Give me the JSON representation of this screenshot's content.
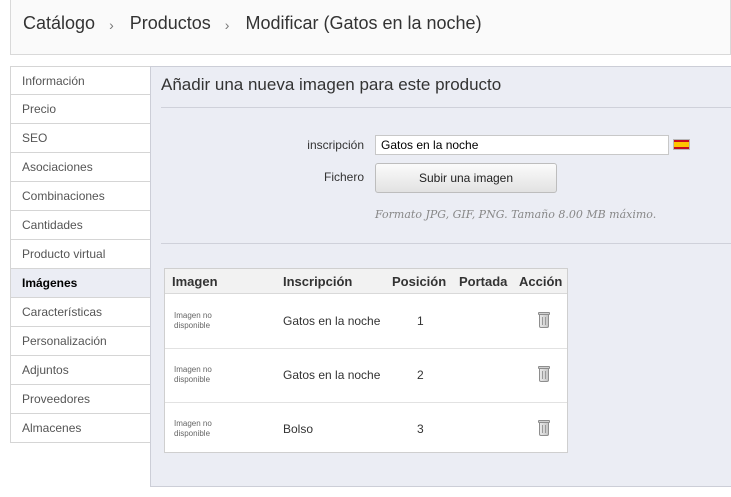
{
  "breadcrumb": {
    "items": [
      "Catálogo",
      "Productos",
      "Modificar (Gatos en la noche)"
    ],
    "separator": "›"
  },
  "sidebar": {
    "items": [
      {
        "label": "Información"
      },
      {
        "label": "Precio"
      },
      {
        "label": "SEO"
      },
      {
        "label": "Asociaciones"
      },
      {
        "label": "Combinaciones"
      },
      {
        "label": "Cantidades"
      },
      {
        "label": "Producto virtual"
      },
      {
        "label": "Imágenes",
        "active": true
      },
      {
        "label": "Características"
      },
      {
        "label": "Personalización"
      },
      {
        "label": "Adjuntos"
      },
      {
        "label": "Proveedores"
      },
      {
        "label": "Almacenes"
      }
    ]
  },
  "form": {
    "title": "Añadir una nueva imagen para este producto",
    "inscription_label": "inscripción",
    "inscription_value": "Gatos en la noche",
    "language_flag": "spain-flag-icon",
    "file_label": "Fichero",
    "upload_button": "Subir una imagen",
    "hint": "Formato JPG, GIF, PNG. Tamaño 8.00 MB máximo."
  },
  "table": {
    "headers": {
      "image": "Imagen",
      "caption": "Inscripción",
      "position": "Posición",
      "cover": "Portada",
      "action": "Acción"
    },
    "rows": [
      {
        "image_text_1": "Imagen no",
        "image_text_2": "disponible",
        "caption": "Gatos en la noche",
        "position": "1",
        "cover": "",
        "action_icon": "trash-icon"
      },
      {
        "image_text_1": "Imagen no",
        "image_text_2": "disponible",
        "caption": "Gatos en la noche",
        "position": "2",
        "cover": "",
        "action_icon": "trash-icon"
      },
      {
        "image_text_1": "Imagen no",
        "image_text_2": "disponible",
        "caption": "Bolso",
        "position": "3",
        "cover": "",
        "action_icon": "trash-icon"
      }
    ]
  },
  "colors": {
    "panel_bg": "#ebedf4",
    "active_tab_bg": "#ebedf4",
    "flag_red": "#c60b1e",
    "flag_yellow": "#ffc400"
  }
}
